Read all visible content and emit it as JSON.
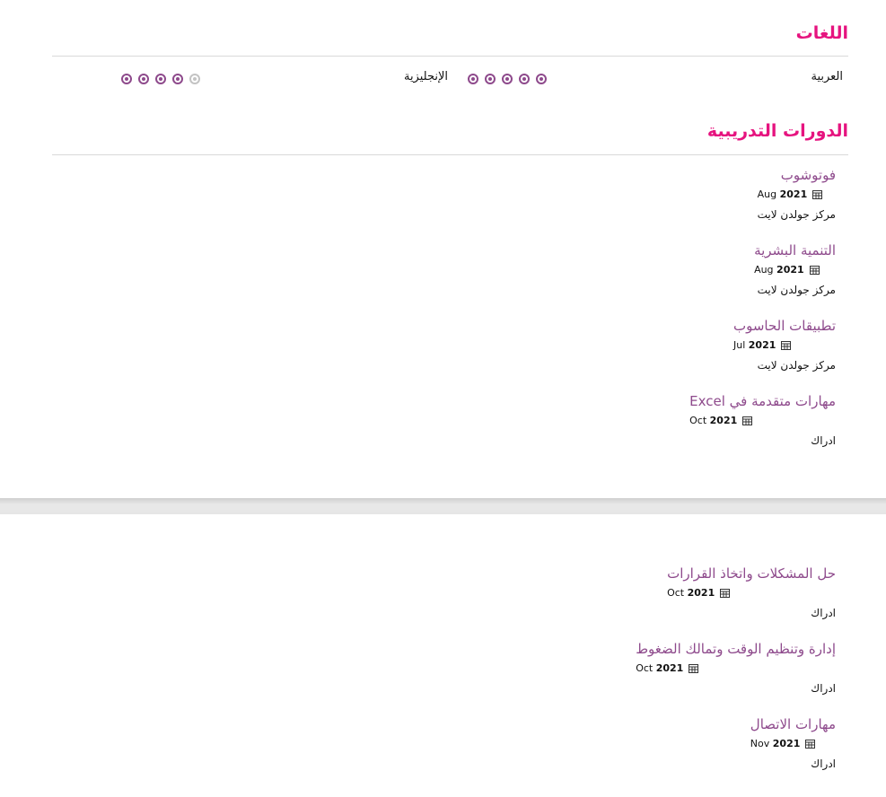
{
  "languages": {
    "title": "اللغات",
    "items": [
      {
        "name": "العربية",
        "level": 5
      },
      {
        "name": "الإنجليزية",
        "level": 4
      }
    ],
    "max": 5
  },
  "courses": {
    "title": "الدورات التدريبية",
    "items": [
      {
        "title": "فوتوشوب",
        "month": "Aug",
        "year": "2021",
        "org": "مركز جولدن لايت"
      },
      {
        "title": "التنمية البشرية",
        "month": "Aug",
        "year": "2021",
        "org": "مركز جولدن لايت"
      },
      {
        "title": "تطبيقات الحاسوب",
        "month": "Jul",
        "year": "2021",
        "org": "مركز جولدن لايت"
      },
      {
        "title": "مهارات متقدمة في Excel",
        "month": "Oct",
        "year": "2021",
        "org": "ادراك"
      }
    ]
  },
  "courses_page2": [
    {
      "title": "حل المشكلات واتخاذ القرارات",
      "month": "Oct",
      "year": "2021",
      "org": "ادراك"
    },
    {
      "title": "إدارة وتنظيم الوقت وتمالك الضغوط",
      "month": "Oct",
      "year": "2021",
      "org": "ادراك"
    },
    {
      "title": "مهارات الاتصال",
      "month": "Nov",
      "year": "2021",
      "org": "ادراك"
    }
  ],
  "colors": {
    "accent": "#e6137f",
    "course_title": "#8e4a8c"
  }
}
